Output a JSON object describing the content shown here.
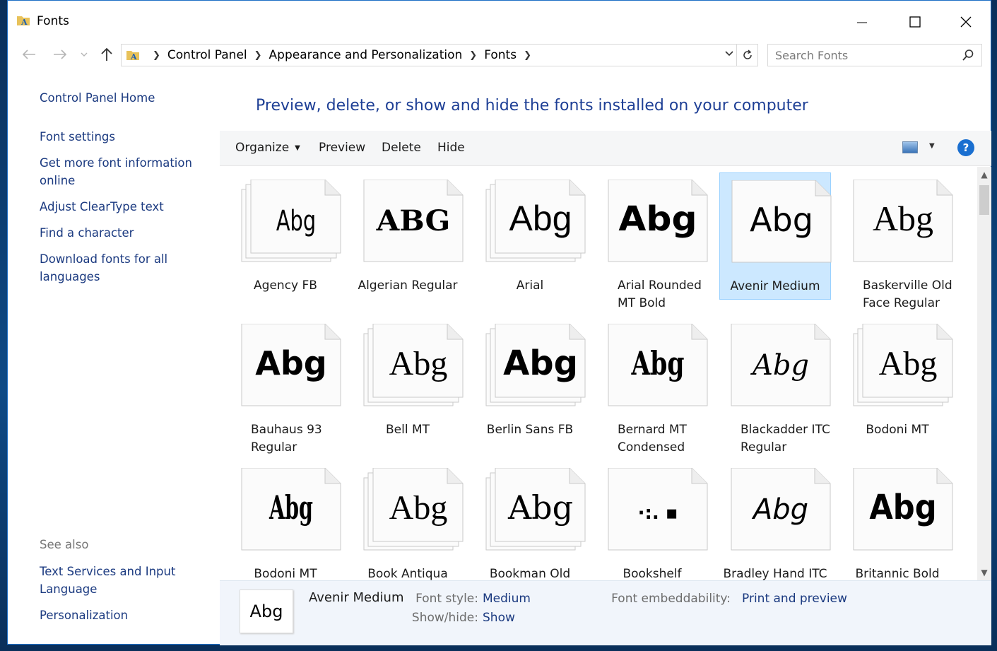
{
  "window": {
    "title": "Fonts",
    "controls": {
      "minimize": "minimize",
      "maximize": "maximize",
      "close": "close"
    }
  },
  "address_bar": {
    "crumbs": [
      "Control Panel",
      "Appearance and Personalization",
      "Fonts"
    ],
    "search_placeholder": "Search Fonts"
  },
  "left_pane": {
    "links": [
      "Control Panel Home",
      "Font settings",
      "Get more font information online",
      "Adjust ClearType text",
      "Find a character",
      "Download fonts for all languages"
    ],
    "see_also_heading": "See also",
    "see_also_links": [
      "Text Services and Input Language",
      "Personalization"
    ]
  },
  "main": {
    "headline": "Preview, delete, or show and hide the fonts installed on your computer",
    "toolbar": {
      "organize": "Organize",
      "preview": "Preview",
      "delete": "Delete",
      "hide": "Hide",
      "help": "?"
    },
    "fonts": [
      {
        "name": "Agency FB",
        "sample": "Abg",
        "family": "stack"
      },
      {
        "name": "Algerian Regular",
        "sample": "ABG",
        "family": "single"
      },
      {
        "name": "Arial",
        "sample": "Abg",
        "family": "stack"
      },
      {
        "name": "Arial Rounded MT Bold",
        "sample": "Abg",
        "family": "single"
      },
      {
        "name": "Avenir Medium",
        "sample": "Abg",
        "family": "single"
      },
      {
        "name": "Baskerville Old Face Regular",
        "sample": "Abg",
        "family": "single"
      },
      {
        "name": "Bauhaus 93 Regular",
        "sample": "Abg",
        "family": "single"
      },
      {
        "name": "Bell MT",
        "sample": "Abg",
        "family": "stack"
      },
      {
        "name": "Berlin Sans FB",
        "sample": "Abg",
        "family": "stack"
      },
      {
        "name": "Bernard MT Condensed",
        "sample": "Abg",
        "family": "single"
      },
      {
        "name": "Blackadder ITC Regular",
        "sample": "Abg",
        "family": "single"
      },
      {
        "name": "Bodoni MT",
        "sample": "Abg",
        "family": "stack"
      },
      {
        "name": "Bodoni MT",
        "sample": "Abg",
        "family": "single"
      },
      {
        "name": "Book Antiqua",
        "sample": "Abg",
        "family": "stack"
      },
      {
        "name": "Bookman Old",
        "sample": "Abg",
        "family": "stack"
      },
      {
        "name": "Bookshelf",
        "sample": "·:. ▪",
        "family": "single"
      },
      {
        "name": "Bradley Hand ITC",
        "sample": "Abg",
        "family": "single"
      },
      {
        "name": "Britannic Bold",
        "sample": "Abg",
        "family": "single"
      }
    ],
    "selected_font": "Avenir Medium"
  },
  "details": {
    "thumb": "Abg",
    "name": "Avenir Medium",
    "font_style_label": "Font style:",
    "font_style_value": "Medium",
    "show_hide_label": "Show/hide:",
    "show_hide_value": "Show",
    "embed_label": "Font embeddability:",
    "embed_value": "Print and preview"
  },
  "colors": {
    "accent": "#1e3f95",
    "link": "#1b3a80",
    "selection": "#cce8ff"
  }
}
